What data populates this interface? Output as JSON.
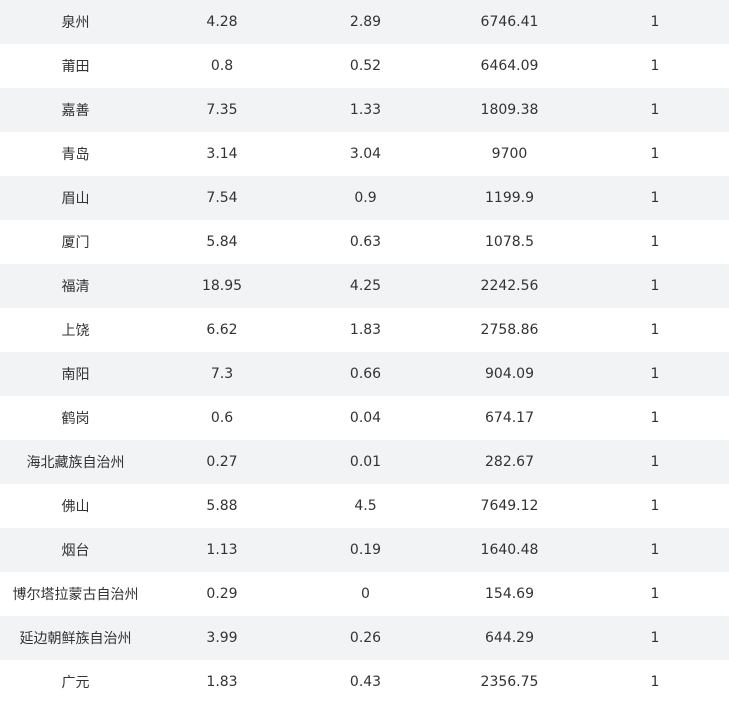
{
  "table": {
    "rows": [
      {
        "city": "泉州",
        "v1": "4.28",
        "v2": "2.89",
        "v3": "6746.41",
        "v4": "1"
      },
      {
        "city": "莆田",
        "v1": "0.8",
        "v2": "0.52",
        "v3": "6464.09",
        "v4": "1"
      },
      {
        "city": "嘉善",
        "v1": "7.35",
        "v2": "1.33",
        "v3": "1809.38",
        "v4": "1"
      },
      {
        "city": "青岛",
        "v1": "3.14",
        "v2": "3.04",
        "v3": "9700",
        "v4": "1"
      },
      {
        "city": "眉山",
        "v1": "7.54",
        "v2": "0.9",
        "v3": "1199.9",
        "v4": "1"
      },
      {
        "city": "厦门",
        "v1": "5.84",
        "v2": "0.63",
        "v3": "1078.5",
        "v4": "1"
      },
      {
        "city": "福清",
        "v1": "18.95",
        "v2": "4.25",
        "v3": "2242.56",
        "v4": "1"
      },
      {
        "city": "上饶",
        "v1": "6.62",
        "v2": "1.83",
        "v3": "2758.86",
        "v4": "1"
      },
      {
        "city": "南阳",
        "v1": "7.3",
        "v2": "0.66",
        "v3": "904.09",
        "v4": "1"
      },
      {
        "city": "鹤岗",
        "v1": "0.6",
        "v2": "0.04",
        "v3": "674.17",
        "v4": "1"
      },
      {
        "city": "海北藏族自治州",
        "v1": "0.27",
        "v2": "0.01",
        "v3": "282.67",
        "v4": "1"
      },
      {
        "city": "佛山",
        "v1": "5.88",
        "v2": "4.5",
        "v3": "7649.12",
        "v4": "1"
      },
      {
        "city": "烟台",
        "v1": "1.13",
        "v2": "0.19",
        "v3": "1640.48",
        "v4": "1"
      },
      {
        "city": "博尔塔拉蒙古自治州",
        "v1": "0.29",
        "v2": "0",
        "v3": "154.69",
        "v4": "1"
      },
      {
        "city": "延边朝鲜族自治州",
        "v1": "3.99",
        "v2": "0.26",
        "v3": "644.29",
        "v4": "1"
      },
      {
        "city": "广元",
        "v1": "1.83",
        "v2": "0.43",
        "v3": "2356.75",
        "v4": "1"
      }
    ]
  }
}
